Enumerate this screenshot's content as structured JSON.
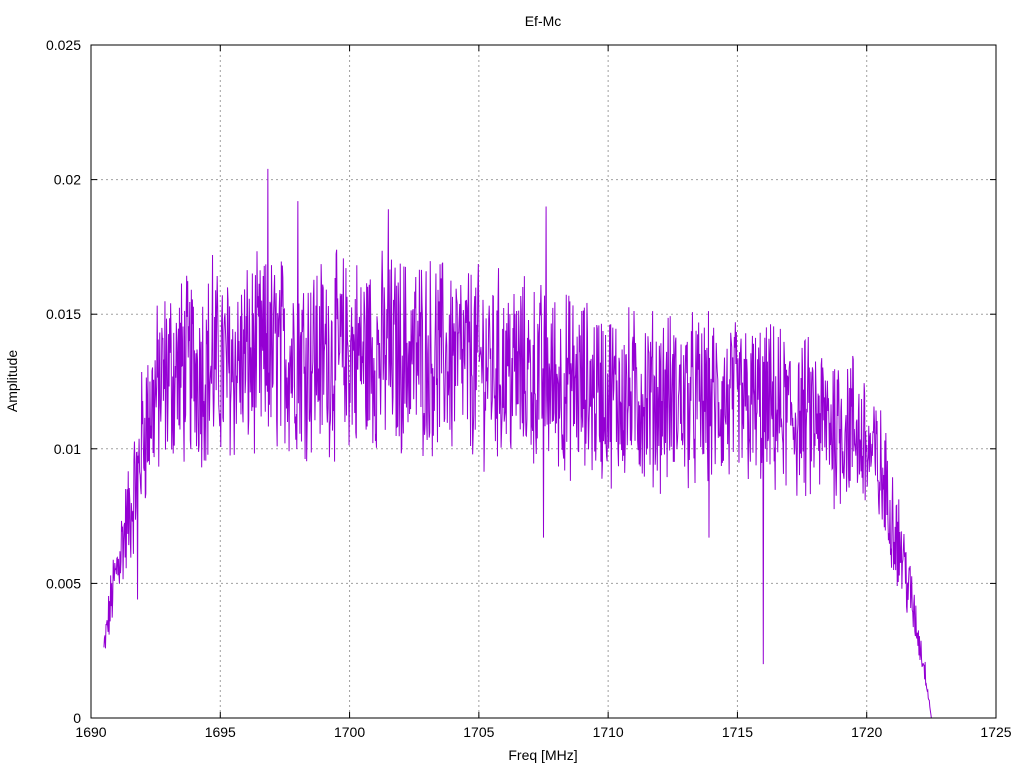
{
  "chart_data": {
    "type": "line",
    "title": "Ef-Mc",
    "xlabel": "Freq [MHz]",
    "ylabel": "Amplitude",
    "xlim": [
      1690,
      1725
    ],
    "ylim": [
      0,
      0.025
    ],
    "x_ticks": [
      "1690",
      "1695",
      "1700",
      "1705",
      "1710",
      "1715",
      "1720",
      "1725"
    ],
    "y_ticks": [
      "0",
      "0.005",
      "0.01",
      "0.015",
      "0.02",
      "0.025"
    ],
    "x_tick_values": [
      1690,
      1695,
      1700,
      1705,
      1710,
      1715,
      1720,
      1725
    ],
    "y_tick_values": [
      0,
      0.005,
      0.01,
      0.015,
      0.02,
      0.025
    ],
    "grid": true,
    "series": [
      {
        "color": "#9400d3",
        "x_start": 1690.5,
        "x_end": 1722.5,
        "envelope_x": [
          1690.5,
          1690.8,
          1691.2,
          1691.6,
          1692.0,
          1692.5,
          1693.0,
          1694.0,
          1695.0,
          1697.0,
          1700.0,
          1703.0,
          1706.0,
          1710.0,
          1713.0,
          1716.0,
          1718.0,
          1719.5,
          1720.0,
          1720.5,
          1721.0,
          1721.5,
          1722.0,
          1722.3,
          1722.5
        ],
        "envelope_y": [
          0.0025,
          0.0045,
          0.0065,
          0.008,
          0.0105,
          0.012,
          0.0128,
          0.013,
          0.013,
          0.0135,
          0.0135,
          0.0135,
          0.013,
          0.012,
          0.0118,
          0.0115,
          0.011,
          0.0108,
          0.01,
          0.0092,
          0.0075,
          0.0055,
          0.003,
          0.0015,
          0.0
        ],
        "peaks": [
          {
            "x": 1696.85,
            "y": 0.0204
          },
          {
            "x": 1698.0,
            "y": 0.0192
          },
          {
            "x": 1701.5,
            "y": 0.0189
          },
          {
            "x": 1707.6,
            "y": 0.019
          },
          {
            "x": 1694.7,
            "y": 0.0172
          }
        ],
        "dips": [
          {
            "x": 1691.8,
            "y": 0.0044
          },
          {
            "x": 1707.5,
            "y": 0.0067
          },
          {
            "x": 1716.0,
            "y": 0.002
          },
          {
            "x": 1713.9,
            "y": 0.0067
          }
        ]
      }
    ]
  }
}
